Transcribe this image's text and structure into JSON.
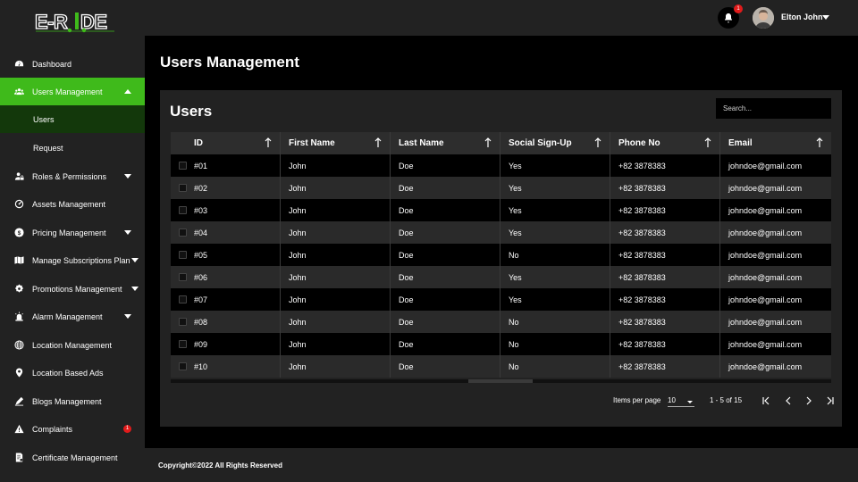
{
  "brand": {
    "logo_text": "E-RIDE",
    "accent": "#3fba1b"
  },
  "header": {
    "notification_count": "1",
    "user_name": "Elton John"
  },
  "sidebar": {
    "items": [
      {
        "label": "Dashboard",
        "icon": "dashboard-icon"
      },
      {
        "label": "Users Management",
        "icon": "users-icon",
        "active": true
      },
      {
        "label": "Users",
        "sub": true,
        "selected": true
      },
      {
        "label": "Request",
        "sub": true
      },
      {
        "label": "Roles & Permissions",
        "icon": "user-lock-icon",
        "dropdown": true
      },
      {
        "label": "Assets Management",
        "icon": "gauge-icon"
      },
      {
        "label": "Pricing Management",
        "icon": "dollar-icon",
        "dropdown": true
      },
      {
        "label": "Manage Subscriptions Plan",
        "icon": "map-icon",
        "dropdown": true
      },
      {
        "label": "Promotions Management",
        "icon": "gear-badge-icon",
        "dropdown": true
      },
      {
        "label": "Alarm Management",
        "icon": "alarm-icon",
        "dropdown": true
      },
      {
        "label": "Location Management",
        "icon": "globe-icon"
      },
      {
        "label": "Location Based Ads",
        "icon": "pin-icon"
      },
      {
        "label": "Blogs Management",
        "icon": "blog-icon"
      },
      {
        "label": "Complaints",
        "icon": "warning-icon",
        "badge": "1"
      },
      {
        "label": "Certificate Management",
        "icon": "certificate-icon"
      }
    ]
  },
  "main": {
    "page_title": "Users Management",
    "card_title": "Users",
    "search_placeholder": "Search...",
    "table": {
      "columns": [
        "ID",
        "First Name",
        "Last Name",
        "Social Sign-Up",
        "Phone No",
        "Email"
      ],
      "rows": [
        [
          "#01",
          "John",
          "Doe",
          "Yes",
          "+82 3878383",
          "johndoe@gmail.com"
        ],
        [
          "#02",
          "John",
          "Doe",
          "Yes",
          "+82 3878383",
          "johndoe@gmail.com"
        ],
        [
          "#03",
          "John",
          "Doe",
          "Yes",
          "+82 3878383",
          "johndoe@gmail.com"
        ],
        [
          "#04",
          "John",
          "Doe",
          "Yes",
          "+82 3878383",
          "johndoe@gmail.com"
        ],
        [
          "#05",
          "John",
          "Doe",
          "No",
          "+82 3878383",
          "johndoe@gmail.com"
        ],
        [
          "#06",
          "John",
          "Doe",
          "Yes",
          "+82 3878383",
          "johndoe@gmail.com"
        ],
        [
          "#07",
          "John",
          "Doe",
          "Yes",
          "+82 3878383",
          "johndoe@gmail.com"
        ],
        [
          "#08",
          "John",
          "Doe",
          "No",
          "+82 3878383",
          "johndoe@gmail.com"
        ],
        [
          "#09",
          "John",
          "Doe",
          "No",
          "+82 3878383",
          "johndoe@gmail.com"
        ],
        [
          "#10",
          "John",
          "Doe",
          "No",
          "+82 3878383",
          "johndoe@gmail.com"
        ]
      ]
    },
    "pagination": {
      "items_per_page_label": "Items per page",
      "items_per_page_value": "10",
      "range_label": "1 - 5 of 15"
    }
  },
  "footer": {
    "text": "Copyright©2022 All Rights Reserved"
  }
}
